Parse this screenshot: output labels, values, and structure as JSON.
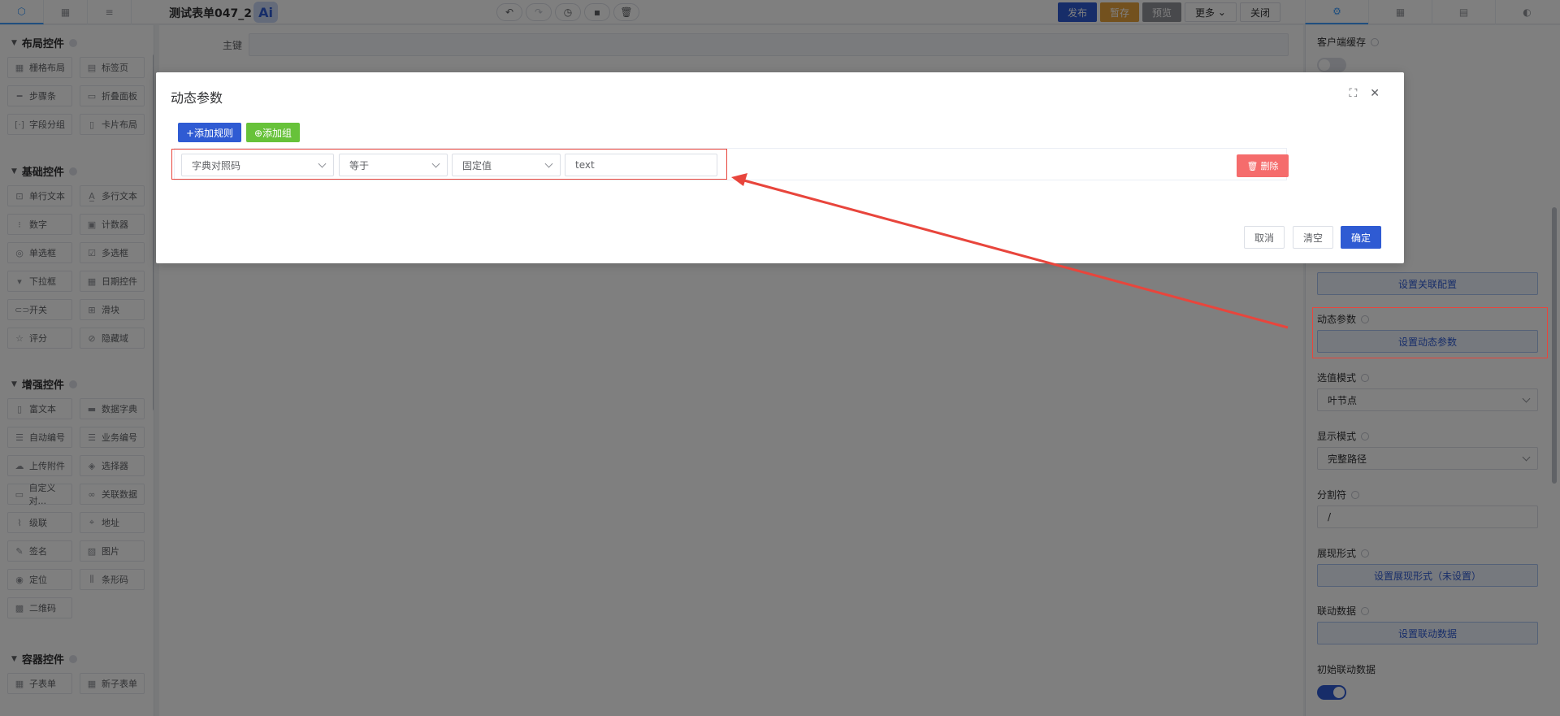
{
  "topbar": {
    "form_title": "测试表单047_2",
    "ai_label": "Ai",
    "publish": "发布",
    "save_draft": "暂存",
    "preview": "预览",
    "more": "更多",
    "close": "关闭"
  },
  "sidebar": {
    "groups": [
      {
        "title": "布局控件",
        "items": [
          "栅格布局",
          "标签页",
          "步骤条",
          "折叠面板",
          "字段分组",
          "卡片布局"
        ]
      },
      {
        "title": "基础控件",
        "items": [
          "单行文本",
          "多行文本",
          "数字",
          "计数器",
          "单选框",
          "多选框",
          "下拉框",
          "日期控件",
          "开关",
          "滑块",
          "评分",
          "隐藏域"
        ]
      },
      {
        "title": "增强控件",
        "items": [
          "富文本",
          "数据字典",
          "自动编号",
          "业务编号",
          "上传附件",
          "选择器",
          "自定义对...",
          "关联数据",
          "级联",
          "地址",
          "签名",
          "图片",
          "定位",
          "条形码",
          "二维码"
        ]
      },
      {
        "title": "容器控件",
        "items": [
          "子表单",
          "新子表单"
        ]
      }
    ]
  },
  "canvas": {
    "primary_key_label": "主键"
  },
  "right_panel": {
    "client_cache_label": "客户端缓存",
    "set_relation_config": "设置关联配置",
    "dynamic_params_label": "动态参数",
    "set_dynamic_params": "设置动态参数",
    "select_mode_label": "选值模式",
    "select_mode_value": "叶节点",
    "display_mode_label": "显示模式",
    "display_mode_value": "完整路径",
    "separator_label": "分割符",
    "separator_value": "/",
    "presentation_label": "展现形式",
    "set_presentation": "设置展现形式（未设置）",
    "linkage_label": "联动数据",
    "set_linkage": "设置联动数据",
    "init_linkage_label": "初始联动数据",
    "client_cache_on": false,
    "init_linkage_on": true
  },
  "dialog": {
    "title": "动态参数",
    "add_rule": "+添加规则",
    "add_group": "⊕添加组",
    "rule": {
      "field": "字典对照码",
      "operator": "等于",
      "value_type": "固定值",
      "value": "text"
    },
    "delete": "删除",
    "cancel": "取消",
    "clear": "清空",
    "confirm": "确定"
  },
  "colors": {
    "primary": "#2f5bd3",
    "success": "#67c23a",
    "danger": "#f56c6c",
    "annotation": "#e8453c"
  }
}
